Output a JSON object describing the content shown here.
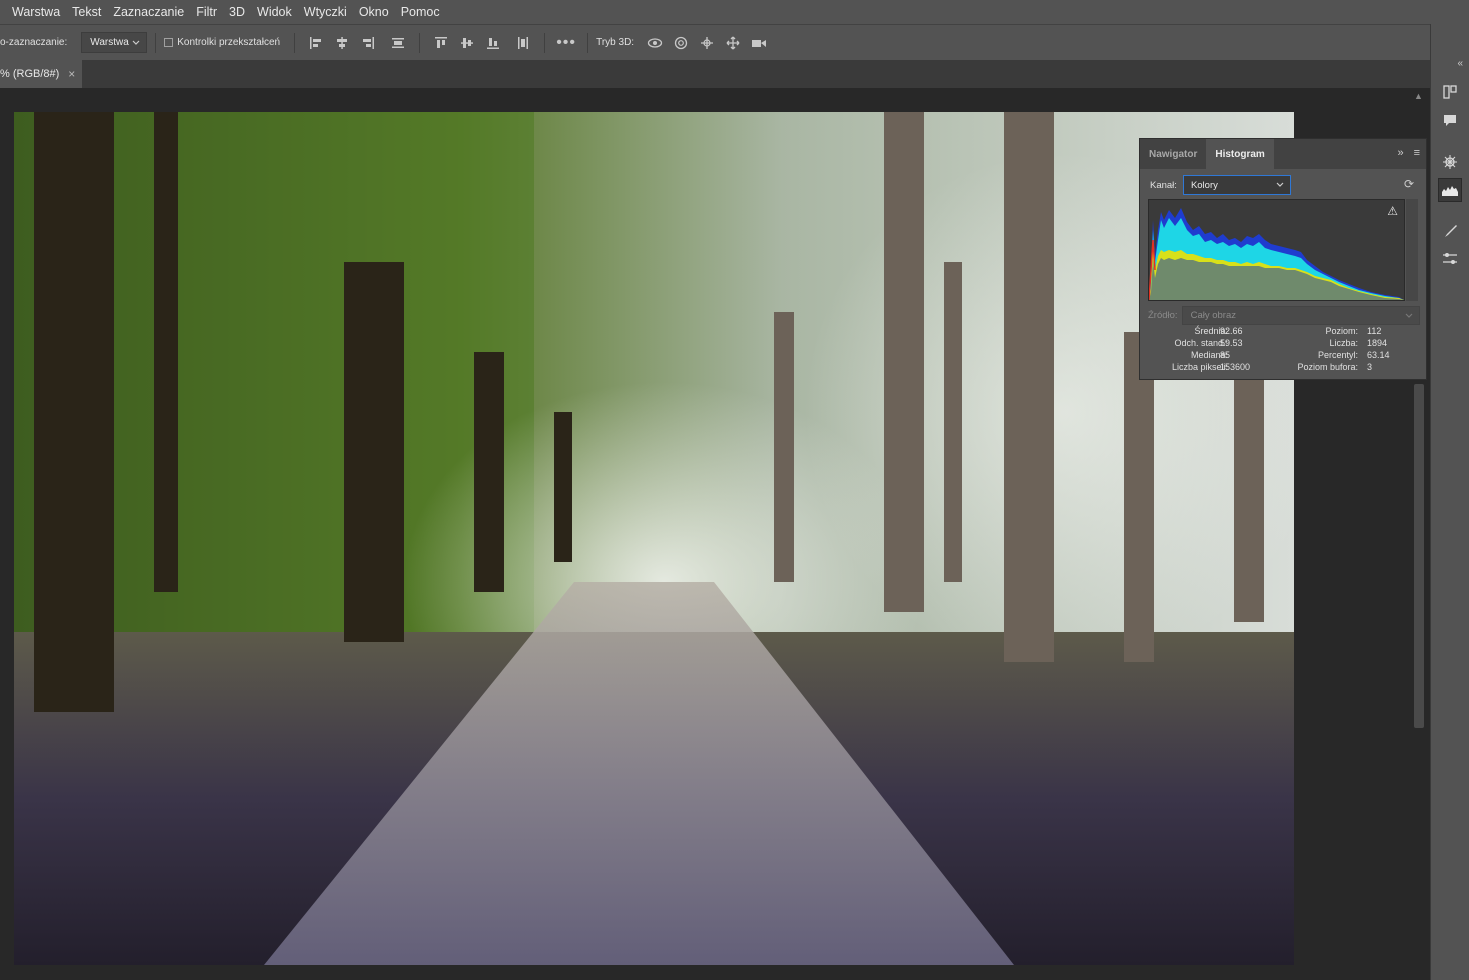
{
  "menu": [
    "Warstwa",
    "Tekst",
    "Zaznaczanie",
    "Filtr",
    "3D",
    "Widok",
    "Wtyczki",
    "Okno",
    "Pomoc"
  ],
  "options_bar": {
    "autoselect_label": "o-zaznaczanie:",
    "autoselect_value": "Warstwa",
    "transform_controls_label": "Kontrolki przekształceń",
    "mode3d_label": "Tryb 3D:"
  },
  "doc_tab": {
    "title": "% (RGB/8#)",
    "close": "×"
  },
  "panel": {
    "tabs": [
      "Nawigator",
      "Histogram"
    ],
    "active_tab": "Histogram",
    "channel_label": "Kanał:",
    "channel_value": "Kolory",
    "source_label": "Źródło:",
    "source_value": "Cały obraz",
    "stats_left": [
      {
        "label": "Średnia:",
        "value": "92.66"
      },
      {
        "label": "Odch. stand.:",
        "value": "59.53"
      },
      {
        "label": "Mediana:",
        "value": "85"
      },
      {
        "label": "Liczba pikseli:",
        "value": "153600"
      }
    ],
    "stats_right": [
      {
        "label": "Poziom:",
        "value": "112"
      },
      {
        "label": "Liczba:",
        "value": "1894"
      },
      {
        "label": "Percentyl:",
        "value": "63.14"
      },
      {
        "label": "Poziom bufora:",
        "value": "3"
      }
    ]
  },
  "colors": {
    "accent": "#2f78d6",
    "panel_bg": "#535353",
    "canvas_bg": "#282828"
  }
}
